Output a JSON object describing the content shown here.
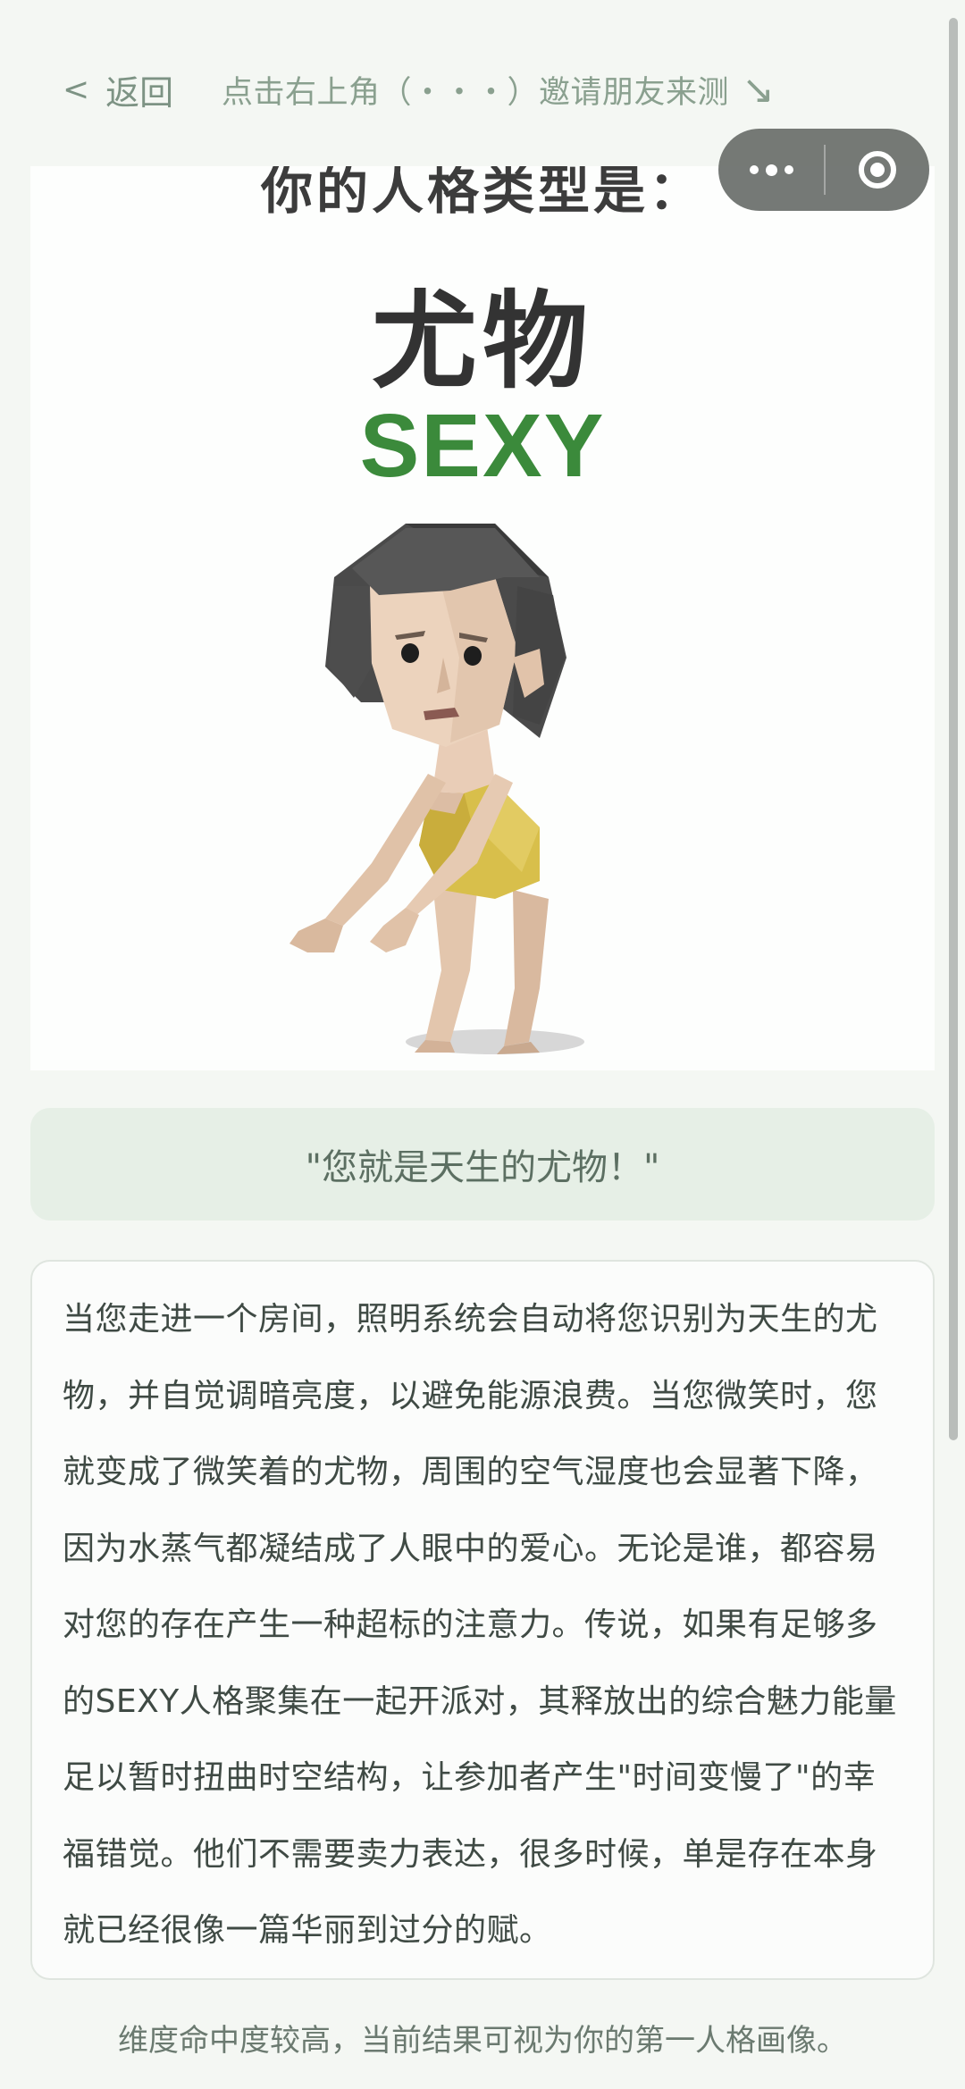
{
  "topbar": {
    "back_chevron": "<",
    "back_label": "返回",
    "invite_tip": "点击右上角（・・・）邀请朋友来测",
    "invite_arrow": "↘"
  },
  "capsule": {
    "more_icon": "more-dots-icon",
    "close_icon": "target-circle-icon"
  },
  "result": {
    "header": "你的人格类型是：",
    "type_name": "尤物",
    "type_code": "SEXY",
    "code_color": "#3b8a3b"
  },
  "quote": "\"您就是天生的尤物！\"",
  "description": "当您走进一个房间，照明系统会自动将您识别为天生的尤物，并自觉调暗亮度，以避免能源浪费。当您微笑时，您就变成了微笑着的尤物，周围的空气湿度也会显著下降，因为水蒸气都凝结成了人眼中的爱心。无论是谁，都容易对您的存在产生一种超标的注意力。传说，如果有足够多的SEXY人格聚集在一起开派对，其释放出的综合魅力能量足以暂时扭曲时空结构，让参加者产生\"时间变慢了\"的幸福错觉。他们不需要卖力表达，很多时候，单是存在本身就已经很像一篇华丽到过分的赋。",
  "footnote": "维度命中度较高，当前结果可视为你的第一人格画像。"
}
